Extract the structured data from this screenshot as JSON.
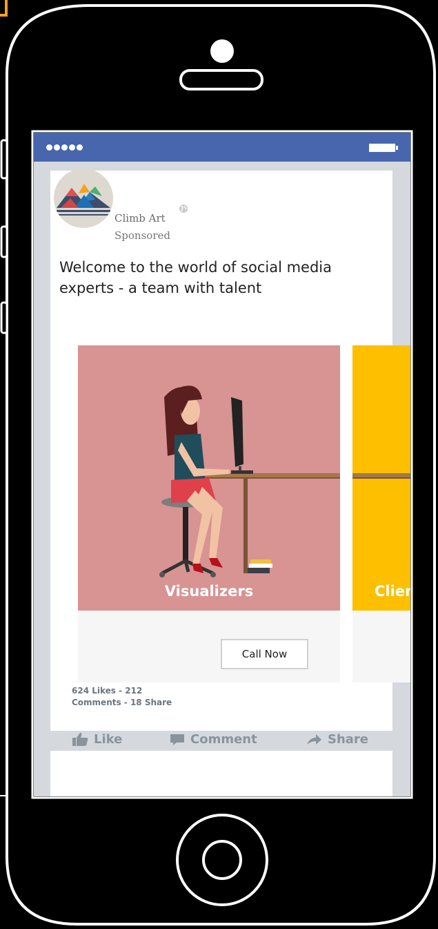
{
  "colors": {
    "status_bar": "#4766ad",
    "card1_bg": "#d89393",
    "card2_bg": "#fdbf00",
    "accent_orange": "#f7a21c"
  },
  "post": {
    "page_name": "Climb Art",
    "sponsored_label": "Sponsored",
    "text": "Welcome to the world of social media experts - a team with talent",
    "carousel": [
      {
        "title": "Visualizers",
        "cta": "Call Now"
      },
      {
        "title": "Client Ser"
      }
    ],
    "stats_line1": "624 Likes  -  212",
    "stats_line2": "Comments  - 18 Share",
    "actions": {
      "like": "Like",
      "comment": "Comment",
      "share": "Share"
    }
  },
  "icons": [
    "signal-dots-icon",
    "battery-icon",
    "globe-icon",
    "thumbs-up-icon",
    "comment-bubble-icon",
    "share-arrow-icon",
    "home-button-icon"
  ]
}
